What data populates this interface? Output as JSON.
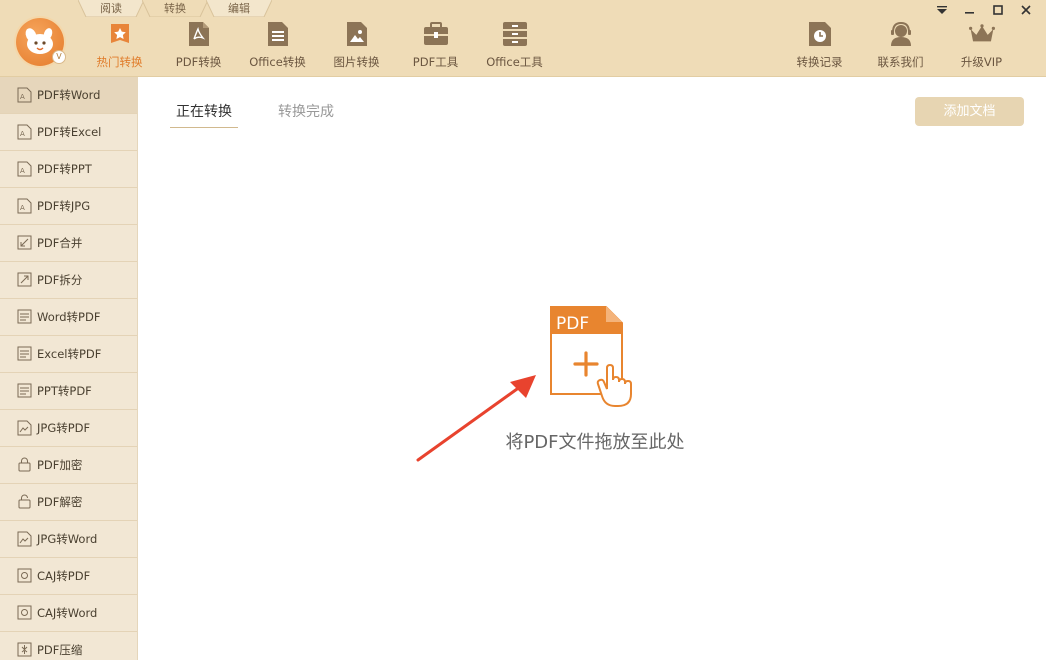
{
  "mode_tabs": [
    "阅读",
    "转换",
    "编辑"
  ],
  "nav": [
    {
      "label": "热门转换",
      "icon": "hot-convert-icon",
      "active": true
    },
    {
      "label": "PDF转换",
      "icon": "pdf-convert-icon"
    },
    {
      "label": "Office转换",
      "icon": "office-convert-icon"
    },
    {
      "label": "图片转换",
      "icon": "image-convert-icon"
    },
    {
      "label": "PDF工具",
      "icon": "pdf-tools-icon"
    },
    {
      "label": "Office工具",
      "icon": "office-tools-icon"
    }
  ],
  "right_nav": [
    {
      "label": "转换记录",
      "icon": "history-icon"
    },
    {
      "label": "联系我们",
      "icon": "support-icon"
    },
    {
      "label": "升级VIP",
      "icon": "crown-icon"
    }
  ],
  "sidebar": [
    {
      "label": "PDF转Word",
      "active": true
    },
    {
      "label": "PDF转Excel"
    },
    {
      "label": "PDF转PPT"
    },
    {
      "label": "PDF转JPG"
    },
    {
      "label": "PDF合并"
    },
    {
      "label": "PDF拆分"
    },
    {
      "label": "Word转PDF"
    },
    {
      "label": "Excel转PDF"
    },
    {
      "label": "PPT转PDF"
    },
    {
      "label": "JPG转PDF"
    },
    {
      "label": "PDF加密"
    },
    {
      "label": "PDF解密"
    },
    {
      "label": "JPG转Word"
    },
    {
      "label": "CAJ转PDF"
    },
    {
      "label": "CAJ转Word"
    },
    {
      "label": "PDF压缩"
    }
  ],
  "subtabs": [
    {
      "label": "正在转换",
      "active": true
    },
    {
      "label": "转换完成"
    }
  ],
  "add_button": "添加文档",
  "dropzone": {
    "badge": "PDF",
    "text": "将PDF文件拖放至此处"
  },
  "colors": {
    "accent": "#e07c2a",
    "topbar": "#efdcb7",
    "sidebar": "#f2e7d4",
    "arrow": "#e8432e"
  }
}
